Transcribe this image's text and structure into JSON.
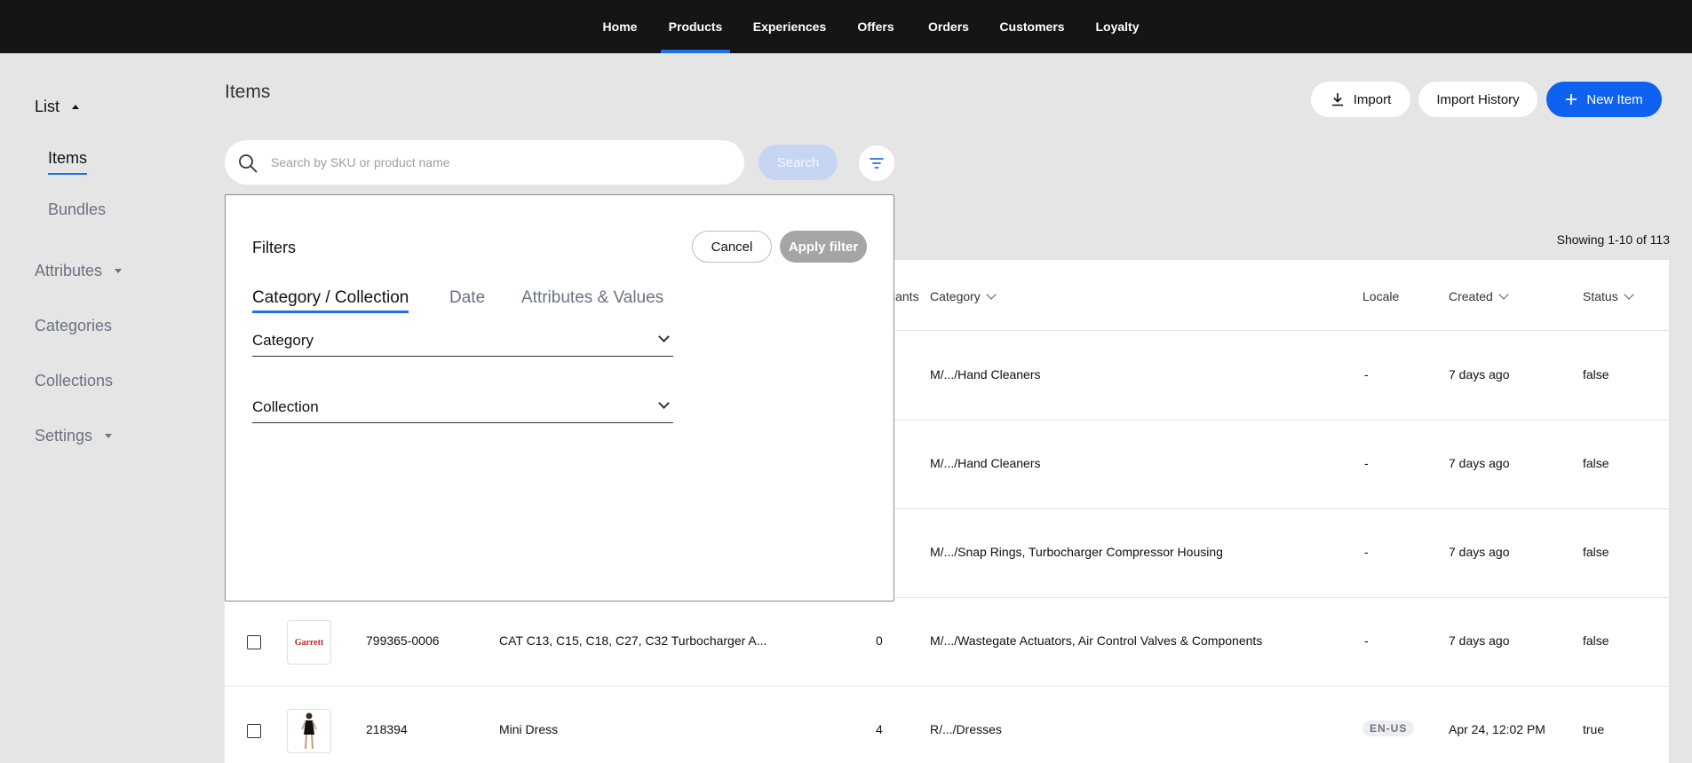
{
  "nav": {
    "items": [
      {
        "label": "Home"
      },
      {
        "label": "Products",
        "active": true
      },
      {
        "label": "Experiences"
      },
      {
        "label": "Offers"
      },
      {
        "label": "Orders"
      },
      {
        "label": "Customers"
      },
      {
        "label": "Loyalty"
      }
    ]
  },
  "sidebar": {
    "list_label": "List",
    "items_label": "Items",
    "bundles_label": "Bundles",
    "attributes_label": "Attributes",
    "categories_label": "Categories",
    "collections_label": "Collections",
    "settings_label": "Settings"
  },
  "header": {
    "title": "Items",
    "import_label": "Import",
    "import_history_label": "Import History",
    "new_item_label": "New Item"
  },
  "search": {
    "placeholder": "Search by SKU or product name",
    "button_label": "Search"
  },
  "showing_text": "Showing 1-10 of 113",
  "table": {
    "columns": {
      "variants": "iants",
      "category": "Category",
      "locale": "Locale",
      "created": "Created",
      "status": "Status"
    },
    "rows": [
      {
        "sku": "",
        "name": "",
        "variants": "",
        "category": "M/.../Hand Cleaners",
        "locale": "-",
        "created": "7 days ago",
        "status": "false"
      },
      {
        "sku": "",
        "name": "",
        "variants": "",
        "category": "M/.../Hand Cleaners",
        "locale": "-",
        "created": "7 days ago",
        "status": "false"
      },
      {
        "sku": "",
        "name": "",
        "variants": "",
        "category": "M/.../Snap Rings, Turbocharger Compressor Housing",
        "locale": "-",
        "created": "7 days ago",
        "status": "false"
      },
      {
        "sku": "799365-0006",
        "name": "CAT C13, C15, C18, C27, C32 Turbocharger A...",
        "variants": "0",
        "category": "M/.../Wastegate Actuators, Air Control Valves & Components",
        "locale": "-",
        "created": "7 days ago",
        "status": "false",
        "thumb_text": "Garrett"
      },
      {
        "sku": "218394",
        "name": "Mini Dress",
        "variants": "4",
        "category": "R/.../Dresses",
        "locale": "EN-US",
        "created": "Apr 24, 12:02 PM",
        "status": "true"
      }
    ]
  },
  "filter_panel": {
    "title": "Filters",
    "cancel_label": "Cancel",
    "apply_label": "Apply filter",
    "tabs": [
      {
        "label": "Category / Collection",
        "active": true
      },
      {
        "label": "Date"
      },
      {
        "label": "Attributes & Values"
      }
    ],
    "category_label": "Category",
    "collection_label": "Collection"
  },
  "colors": {
    "accent": "#0f62f0",
    "nav_bg": "#151515",
    "page_bg": "#e5e5e5"
  }
}
